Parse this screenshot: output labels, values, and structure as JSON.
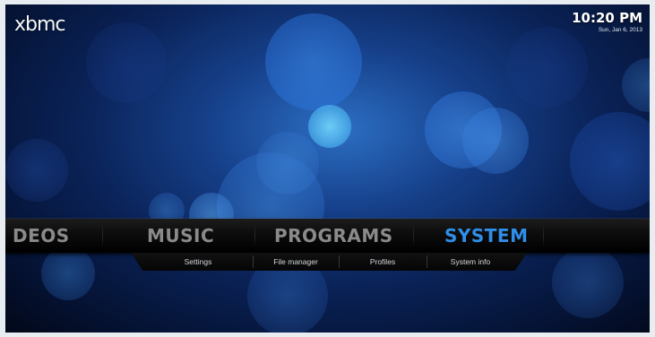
{
  "header": {
    "logo_text": "xbmc",
    "time": "10:20 PM",
    "date": "Sun, Jan 6, 2013"
  },
  "main_menu": {
    "items": [
      {
        "label": "DEOS",
        "selected": false
      },
      {
        "label": "MUSIC",
        "selected": false
      },
      {
        "label": "PROGRAMS",
        "selected": false
      },
      {
        "label": "SYSTEM",
        "selected": true
      }
    ]
  },
  "sub_menu": {
    "items": [
      {
        "label": "Settings"
      },
      {
        "label": "File manager"
      },
      {
        "label": "Profiles"
      },
      {
        "label": "System info"
      }
    ]
  },
  "colors": {
    "selected": "#2f8ee8",
    "unselected": "#8a8a8a",
    "background_dark": "#04102e"
  }
}
